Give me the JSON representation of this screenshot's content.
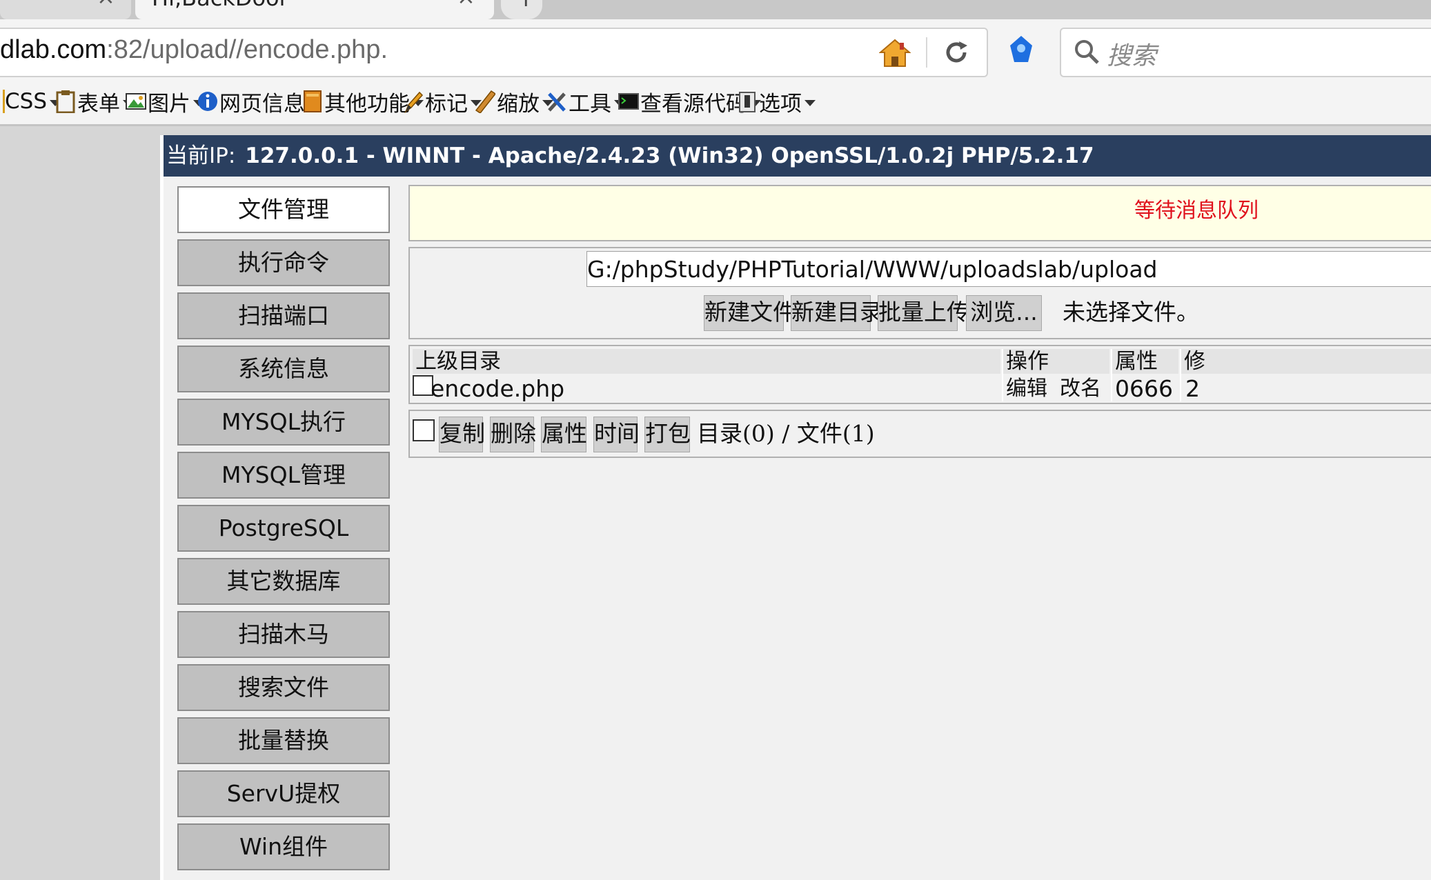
{
  "browser": {
    "tab_title": "Hi,BackDoor",
    "tab_close_glyph": "×",
    "newtab_glyph": "+",
    "url_host": "dlab.com",
    "url_path": ":82/upload//encode.php.",
    "search_placeholder": "搜索"
  },
  "toolbar": {
    "items": [
      {
        "label": "CSS",
        "icon": "css-icon"
      },
      {
        "label": "表单",
        "icon": "clipboard-icon"
      },
      {
        "label": "图片",
        "icon": "image-icon"
      },
      {
        "label": "网页信息",
        "icon": "info-icon"
      },
      {
        "label": "其他功能",
        "icon": "book-icon"
      },
      {
        "label": "标记",
        "icon": "pencil-icon"
      },
      {
        "label": "缩放",
        "icon": "ruler-icon"
      },
      {
        "label": "工具",
        "icon": "tools-icon"
      },
      {
        "label": "查看源代码",
        "icon": "terminal-icon"
      },
      {
        "label": "选项",
        "icon": "switch-icon"
      }
    ]
  },
  "header": {
    "ip_label": "当前IP:",
    "ip_value": "127.0.0.1 - WINNT - Apache/2.4.23 (Win32) OpenSSL/1.0.2j PHP/5.2.17"
  },
  "sidebar": {
    "items": [
      {
        "label": "文件管理",
        "active": true
      },
      {
        "label": "执行命令"
      },
      {
        "label": "扫描端口"
      },
      {
        "label": "系统信息"
      },
      {
        "label": "MYSQL执行"
      },
      {
        "label": "MYSQL管理"
      },
      {
        "label": "PostgreSQL"
      },
      {
        "label": "其它数据库"
      },
      {
        "label": "扫描木马"
      },
      {
        "label": "搜索文件"
      },
      {
        "label": "批量替换"
      },
      {
        "label": "ServU提权"
      },
      {
        "label": "Win组件"
      }
    ]
  },
  "message": {
    "text": "等待消息队列",
    "color": "#e0101c"
  },
  "path_panel": {
    "path_value": "G:/phpStudy/PHPTutorial/WWW/uploadslab/upload",
    "new_file": "新建文件",
    "new_dir": "新建目录",
    "batch_upload": "批量上传",
    "browse": "浏览...",
    "no_file": "未选择文件。"
  },
  "file_table": {
    "headers": {
      "name": "上级目录",
      "actions": "操作",
      "perms": "属性",
      "extra": "修"
    },
    "rows": [
      {
        "name": "encode.php",
        "edit": "编辑",
        "rename": "改名",
        "perms": "0666",
        "extra": "2"
      }
    ]
  },
  "actions": {
    "copy": "复制",
    "delete": "删除",
    "attrs": "属性",
    "time": "时间",
    "pack": "打包",
    "counts": "目录(0) / 文件(1)"
  },
  "colors": {
    "header_bg": "#2a3f5f",
    "message_bg": "#ffffe6",
    "menu_bg": "#c0c0c0"
  }
}
